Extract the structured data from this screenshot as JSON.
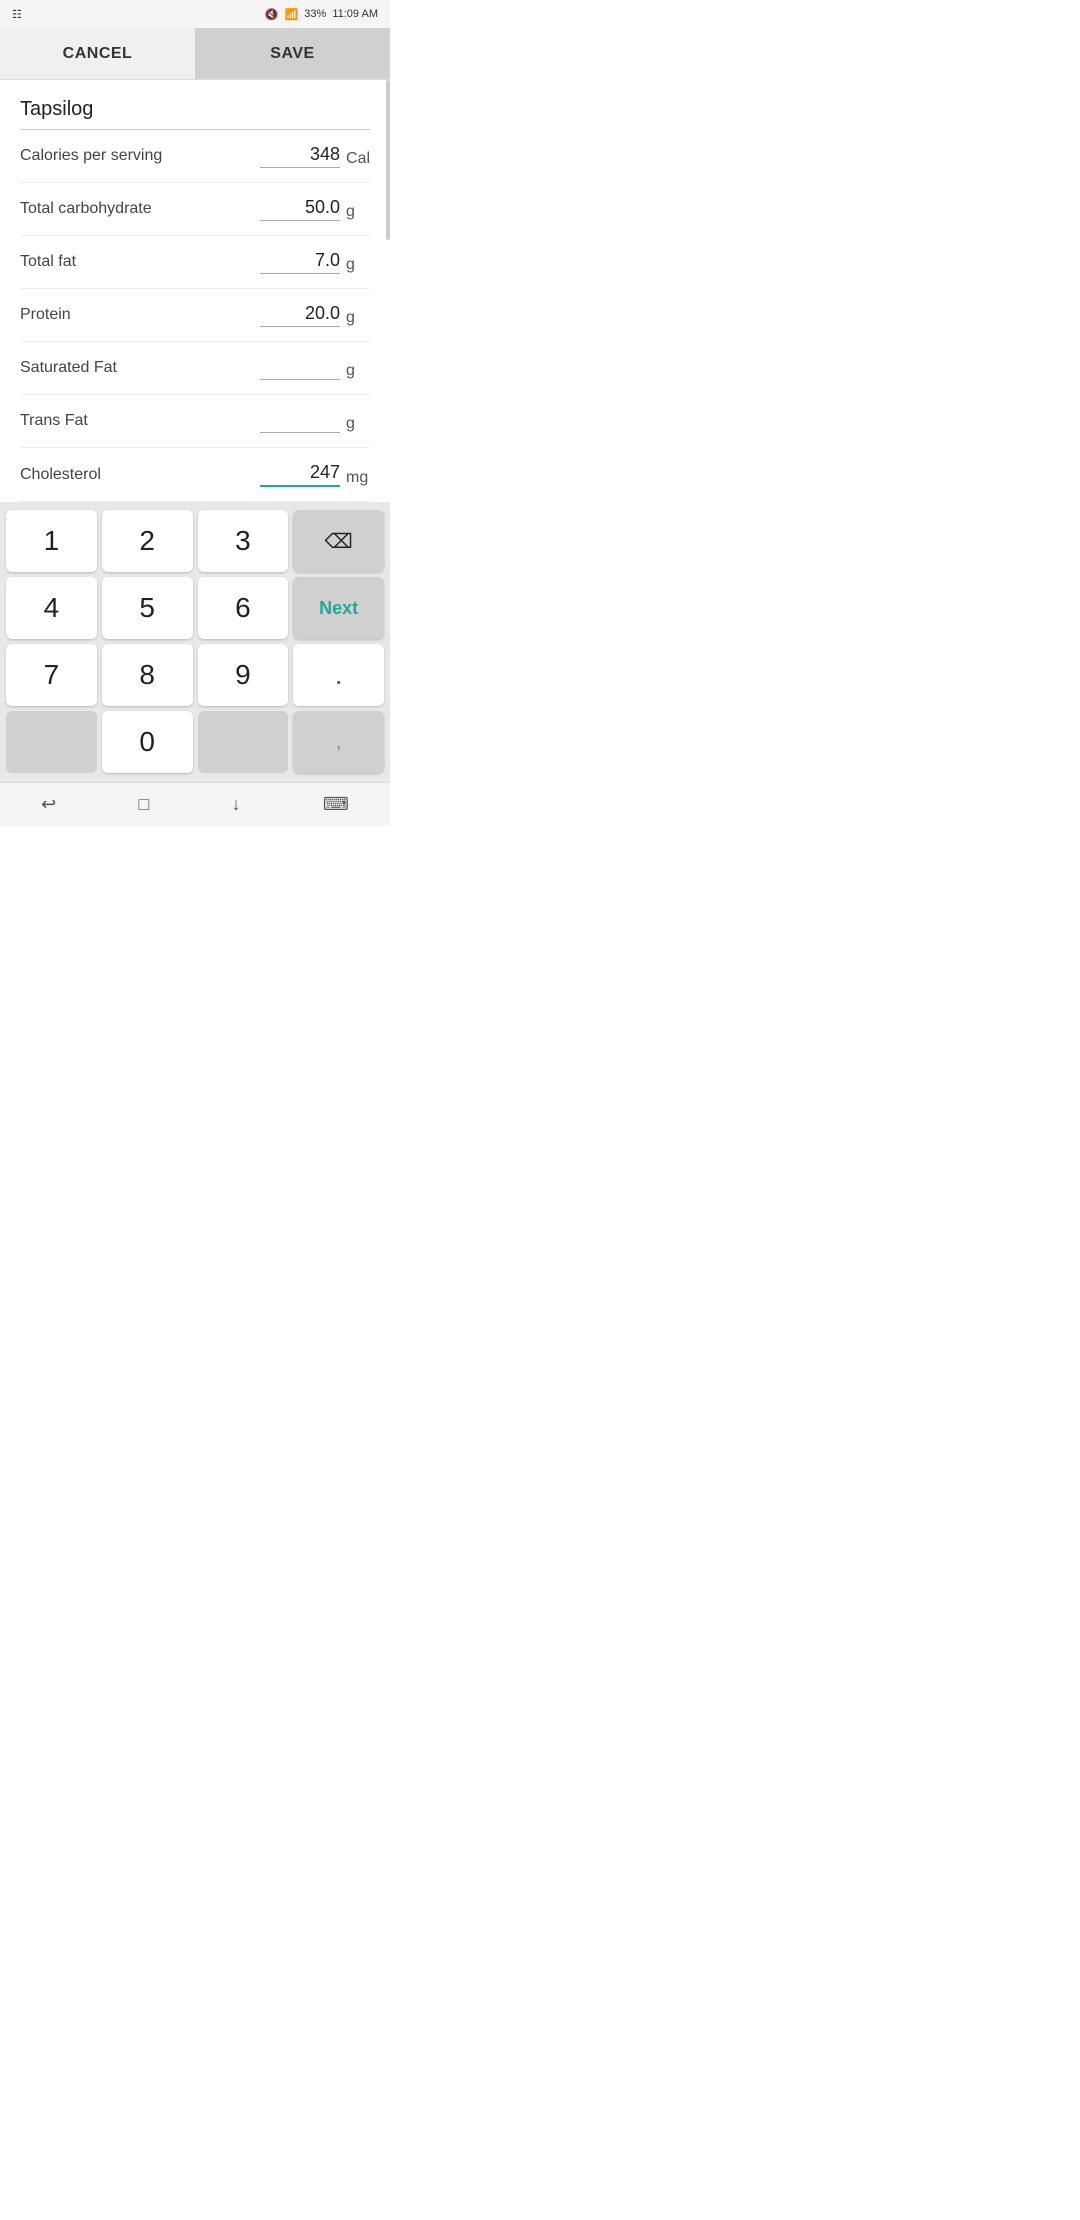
{
  "statusBar": {
    "leftIcon": "☷",
    "muteIcon": "🔇",
    "wifiIcon": "wifi",
    "signalIcon": "signal",
    "battery": "33%",
    "time": "11:09 AM"
  },
  "actionBar": {
    "cancelLabel": "CANCEL",
    "saveLabel": "SAVE"
  },
  "form": {
    "foodName": "Tapsilog",
    "fields": [
      {
        "label": "Calories per serving",
        "value": "348",
        "unit": "Cal",
        "active": false
      },
      {
        "label": "Total carbohydrate",
        "value": "50.0",
        "unit": "g",
        "active": false
      },
      {
        "label": "Total fat",
        "value": "7.0",
        "unit": "g",
        "active": false
      },
      {
        "label": "Protein",
        "value": "20.0",
        "unit": "g",
        "active": false
      },
      {
        "label": "Saturated Fat",
        "value": "",
        "unit": "g",
        "active": false
      },
      {
        "label": "Trans Fat",
        "value": "",
        "unit": "g",
        "active": false
      },
      {
        "label": "Cholesterol",
        "value": "247",
        "unit": "mg",
        "active": true
      }
    ]
  },
  "keyboard": {
    "rows": [
      [
        "1",
        "2",
        "3",
        "⌫"
      ],
      [
        "4",
        "5",
        "6",
        "Next"
      ],
      [
        "7",
        "8",
        "9",
        "."
      ],
      [
        "",
        "0",
        "",
        ","
      ]
    ]
  },
  "navBar": {
    "icons": [
      "↩",
      "□",
      "↓",
      "⌨"
    ]
  }
}
